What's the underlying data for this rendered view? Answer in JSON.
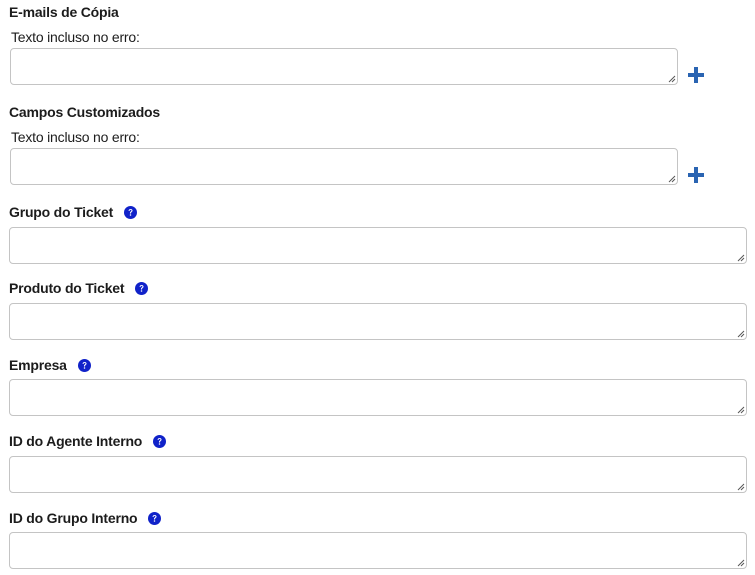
{
  "emails_copia": {
    "title": "E-mails de Cópia",
    "sublabel": "Texto incluso no erro:",
    "value": "",
    "add_icon": "plus-icon"
  },
  "campos_customizados": {
    "title": "Campos Customizados",
    "sublabel": "Texto incluso no erro:",
    "value": "",
    "add_icon": "plus-icon"
  },
  "fields": [
    {
      "label": "Grupo do Ticket",
      "value": "",
      "help_icon": "question-circle-icon"
    },
    {
      "label": "Produto do Ticket",
      "value": "",
      "help_icon": "question-circle-icon"
    },
    {
      "label": "Empresa",
      "value": "",
      "help_icon": "question-circle-icon"
    },
    {
      "label": "ID do Agente Interno",
      "value": "",
      "help_icon": "question-circle-icon"
    },
    {
      "label": "ID do Grupo Interno",
      "value": "",
      "help_icon": "question-circle-icon"
    }
  ],
  "colors": {
    "plus": "#2a64b2",
    "help": "#1022c9",
    "border": "#c4c4c4"
  }
}
